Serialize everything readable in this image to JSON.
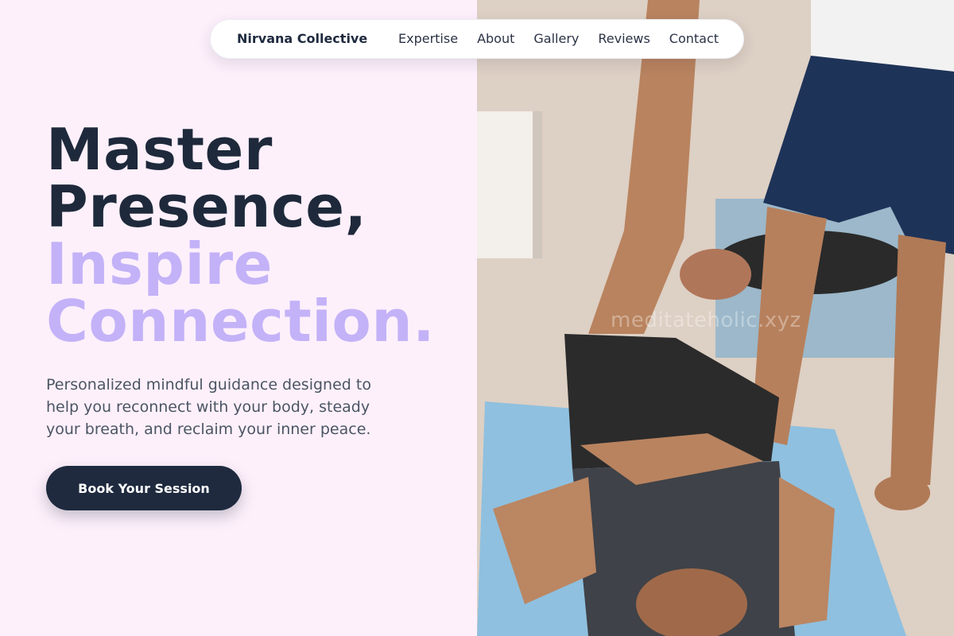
{
  "nav": {
    "brand": "Nirvana Collective",
    "links": [
      {
        "label": "Expertise"
      },
      {
        "label": "About"
      },
      {
        "label": "Gallery"
      },
      {
        "label": "Reviews"
      },
      {
        "label": "Contact"
      }
    ]
  },
  "hero": {
    "headline_line1": "Master",
    "headline_line2": "Presence,",
    "headline_line3": "Inspire",
    "headline_line4": "Connection.",
    "lead": "Personalized mindful guidance designed to help you reconnect with your body, steady your breath, and reclaim your inner peace.",
    "cta_label": "Book Your Session"
  },
  "photo": {
    "watermark": "meditateholic.xyz"
  },
  "colors": {
    "background": "#fdf0fb",
    "ink": "#1e293b",
    "accent": "#c3b2f7",
    "button": "#1f2a3f"
  }
}
